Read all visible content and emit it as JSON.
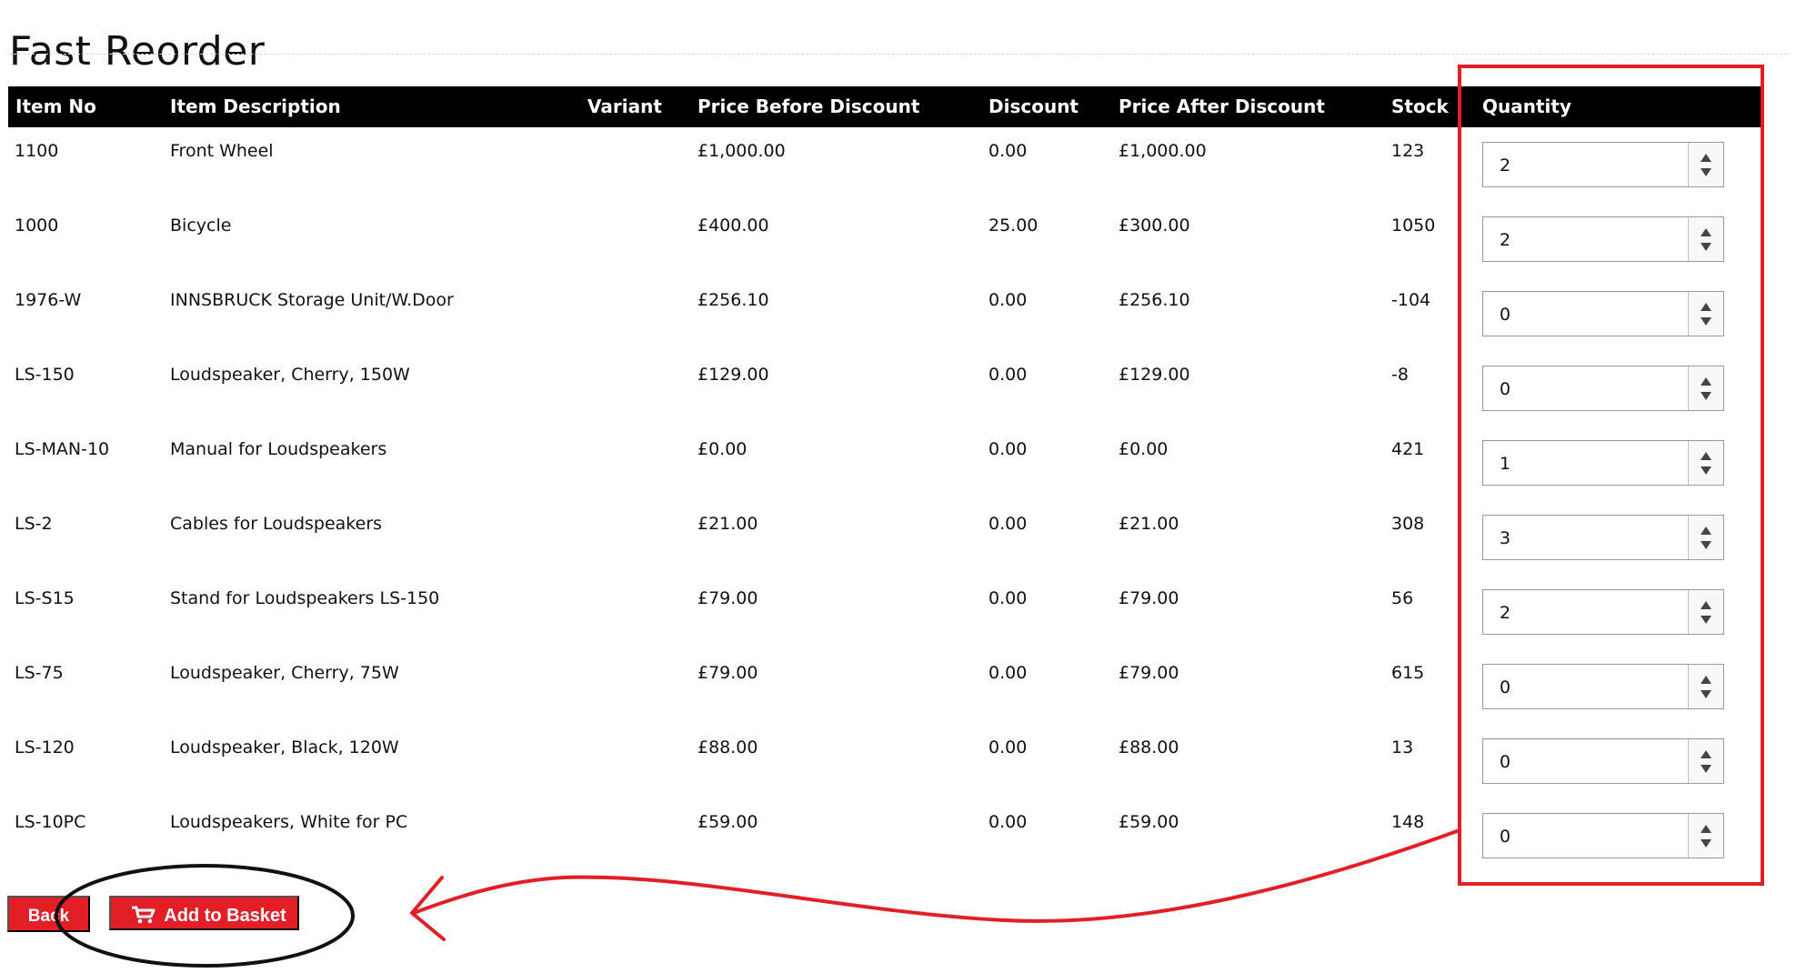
{
  "page": {
    "title": "Fast Reorder"
  },
  "table": {
    "headers": [
      "Item No",
      "Item Description",
      "Variant",
      "Price Before Discount",
      "Discount",
      "Price After Discount",
      "Stock",
      "Quantity"
    ],
    "rows": [
      {
        "item_no": "1100",
        "description": "Front Wheel",
        "variant": "",
        "price_before": "£1,000.00",
        "discount": "0.00",
        "price_after": "£1,000.00",
        "stock": "123",
        "quantity": "2"
      },
      {
        "item_no": "1000",
        "description": "Bicycle",
        "variant": "",
        "price_before": "£400.00",
        "discount": "25.00",
        "price_after": "£300.00",
        "stock": "1050",
        "quantity": "2"
      },
      {
        "item_no": "1976-W",
        "description": "INNSBRUCK Storage Unit/W.Door",
        "variant": "",
        "price_before": "£256.10",
        "discount": "0.00",
        "price_after": "£256.10",
        "stock": "-104",
        "quantity": "0"
      },
      {
        "item_no": "LS-150",
        "description": "Loudspeaker, Cherry, 150W",
        "variant": "",
        "price_before": "£129.00",
        "discount": "0.00",
        "price_after": "£129.00",
        "stock": "-8",
        "quantity": "0"
      },
      {
        "item_no": "LS-MAN-10",
        "description": "Manual for Loudspeakers",
        "variant": "",
        "price_before": "£0.00",
        "discount": "0.00",
        "price_after": "£0.00",
        "stock": "421",
        "quantity": "1"
      },
      {
        "item_no": "LS-2",
        "description": "Cables for Loudspeakers",
        "variant": "",
        "price_before": "£21.00",
        "discount": "0.00",
        "price_after": "£21.00",
        "stock": "308",
        "quantity": "3"
      },
      {
        "item_no": "LS-S15",
        "description": "Stand for Loudspeakers LS-150",
        "variant": "",
        "price_before": "£79.00",
        "discount": "0.00",
        "price_after": "£79.00",
        "stock": "56",
        "quantity": "2"
      },
      {
        "item_no": "LS-75",
        "description": "Loudspeaker, Cherry, 75W",
        "variant": "",
        "price_before": "£79.00",
        "discount": "0.00",
        "price_after": "£79.00",
        "stock": "615",
        "quantity": "0"
      },
      {
        "item_no": "LS-120",
        "description": "Loudspeaker, Black, 120W",
        "variant": "",
        "price_before": "£88.00",
        "discount": "0.00",
        "price_after": "£88.00",
        "stock": "13",
        "quantity": "0"
      },
      {
        "item_no": "LS-10PC",
        "description": "Loudspeakers, White for PC",
        "variant": "",
        "price_before": "£59.00",
        "discount": "0.00",
        "price_after": "£59.00",
        "stock": "148",
        "quantity": "0"
      }
    ]
  },
  "actions": {
    "back_label": "Back",
    "add_to_basket_label": "Add to Basket"
  },
  "icons": {
    "basket": "shopping-cart-icon",
    "spinner_up": "spinner-up-icon",
    "spinner_down": "spinner-down-icon"
  },
  "colors": {
    "header_background": "#000000",
    "button_background": "#e21f26",
    "annotation_red": "#e21f26",
    "annotation_black": "#111111"
  }
}
